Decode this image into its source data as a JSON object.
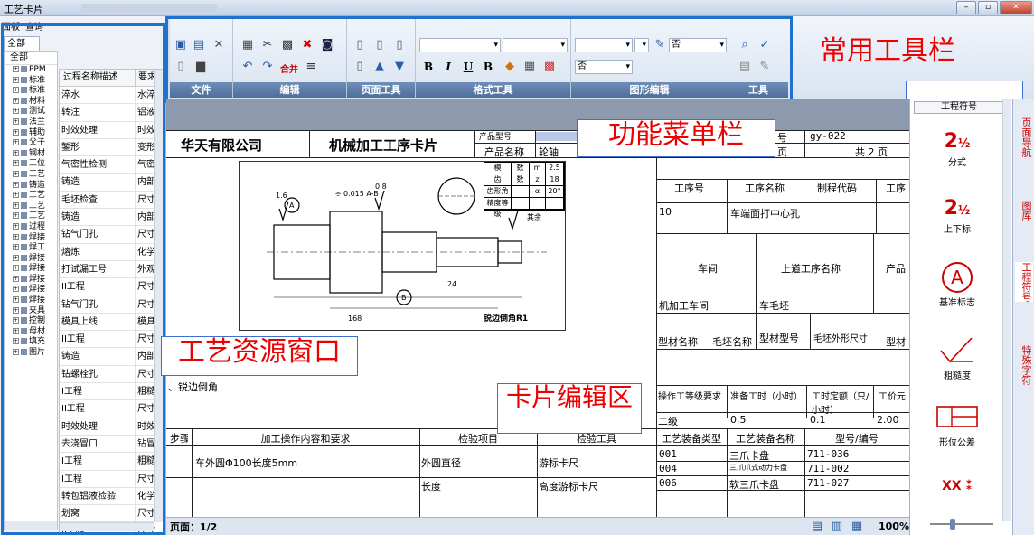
{
  "window": {
    "title": "工艺卡片",
    "buttons": {
      "minimize": "–",
      "restore": "▫",
      "close": "✕"
    }
  },
  "left_panel": {
    "top_tabs": [
      "面板",
      "查询"
    ],
    "tab_all": "全部",
    "tree_header": "全部",
    "tree_items": [
      "PPM",
      "标准",
      "标准",
      "材料",
      "测试",
      "法兰",
      "辅助",
      "父子",
      "钢材",
      "工位",
      "工艺",
      "铸造",
      "工艺",
      "工艺",
      "工艺",
      "过程",
      "焊接",
      "焊工",
      "焊接",
      "焊接",
      "焊接",
      "焊接",
      "焊接",
      "夹具",
      "控制",
      "母材",
      "填充",
      "图片"
    ],
    "process_columns": [
      "过程名称描述",
      "要求"
    ],
    "process_rows": [
      [
        "淬水",
        "水淬"
      ],
      [
        "转注",
        "铝液"
      ],
      [
        "时效处理",
        "时效"
      ],
      [
        "錾形",
        "变形"
      ],
      [
        "气密性检测",
        "气密"
      ],
      [
        "铸造",
        "内部"
      ],
      [
        "毛坯检查",
        "尺寸"
      ],
      [
        "铸造",
        "内部"
      ],
      [
        "钻气门孔",
        "尺寸"
      ],
      [
        "熔炼",
        "化学"
      ],
      [
        "打试漏工号",
        "外观"
      ],
      [
        "II工程",
        "尺寸"
      ],
      [
        "钻气门孔",
        "尺寸"
      ],
      [
        "模具上线",
        "模具"
      ],
      [
        "II工程",
        "尺寸"
      ],
      [
        "铸造",
        "内部"
      ],
      [
        "钻螺栓孔",
        "尺寸"
      ],
      [
        "I工程",
        "粗糙"
      ],
      [
        "II工程",
        "尺寸"
      ],
      [
        "时效处理",
        "时效"
      ],
      [
        "去浇冒口",
        "钻冒"
      ],
      [
        "I工程",
        "粗糙"
      ],
      [
        "I工程",
        "尺寸"
      ],
      [
        "转包铝液检验",
        "化学"
      ],
      [
        "划窝",
        "尺寸"
      ],
      [
        "II工程",
        "尺寸"
      ]
    ]
  },
  "ribbon": {
    "groups": [
      "文件",
      "编辑",
      "页面工具",
      "格式工具",
      "图形编辑",
      "工具"
    ],
    "merge_label": "合并",
    "format_buttons": [
      "B",
      "I",
      "U",
      "B"
    ],
    "combo_no_1": "否",
    "combo_no_2": "否"
  },
  "annotations": {
    "menu_bar": "功能菜单栏",
    "common_toolbar": "常用工具栏",
    "resource_window": "工艺资源窗口",
    "card_edit_area": "卡片编辑区"
  },
  "card": {
    "company": "华天有限公司",
    "card_title": "机械加工工序卡片",
    "product_type_label": "产品型号",
    "product_name_label": "产品名称",
    "product_name": "轮轴",
    "number_label": "号",
    "number": "gy-022",
    "page_label": "页",
    "total_pages": "共 2 页",
    "op_no_label": "工序号",
    "op_name_label": "工序名称",
    "code_label": "制程代码",
    "op_more_label": "工序",
    "op_no": "10",
    "op_name": "车端面打中心孔",
    "workshop_label": "车间",
    "prev_op_label": "上道工序名称",
    "product_label2": "产品",
    "workshop": "机加工车间",
    "prev_op": "车毛坯",
    "material_name_label": "型材名称",
    "blank_name_label": "毛坯名称",
    "material_type_label": "型材型号",
    "blank_size_label": "毛坯外形尺寸",
    "material_label3": "型材",
    "operator_label": "操作工等级要求",
    "prep_label": "准备工时（小时）",
    "std_time_label": "工时定额（只/小时）",
    "price_label": "工价元",
    "operator_level": "二级",
    "prep_time": "0.5",
    "std_time": "0.1",
    "price": "2.00",
    "deburr_note": "、锐边倒角",
    "drawing_note": "锐边倒角R1",
    "tbl_headers": [
      "步骤号",
      "加工操作内容和要求",
      "检验项目",
      "检验工具",
      "工艺装备类型",
      "工艺装备名称",
      "型号/编号"
    ],
    "steps": [
      {
        "content": "车外圆Φ100长度5mm",
        "item": "外圆直径",
        "tool": "游标卡尺"
      },
      {
        "content": "",
        "item": "长度",
        "tool": "高度游标卡尺"
      }
    ],
    "equipment": [
      {
        "type": "001",
        "name": "三爪卡盘",
        "model": "711-036"
      },
      {
        "type": "004",
        "name": "三爪爪式动力卡盘",
        "model": "711-002"
      },
      {
        "type": "006",
        "name": "软三爪卡盘",
        "model": "711-027"
      }
    ],
    "gear_table": [
      [
        "模",
        "数",
        "m",
        "2.5"
      ],
      [
        "齿",
        "数",
        "z",
        "18"
      ],
      [
        "齿形角",
        "",
        "α",
        "20°"
      ],
      [
        "精度等级",
        "",
        "",
        ""
      ]
    ]
  },
  "status": {
    "page": "页面：1/2",
    "zoom": "100%"
  },
  "right_panel": {
    "header": "工程符号",
    "symbols": [
      {
        "icon": "fraction-icon",
        "label": "分式"
      },
      {
        "icon": "stacked-fraction-icon",
        "label": "上下标"
      },
      {
        "icon": "datum-icon",
        "label": "基准标志"
      },
      {
        "icon": "roughness-icon",
        "label": "粗糙度"
      },
      {
        "icon": "tolerance-icon",
        "label": "形位公差"
      }
    ],
    "side_tabs": [
      "页面导航",
      "图库",
      "工程符号",
      "特殊字符"
    ]
  }
}
